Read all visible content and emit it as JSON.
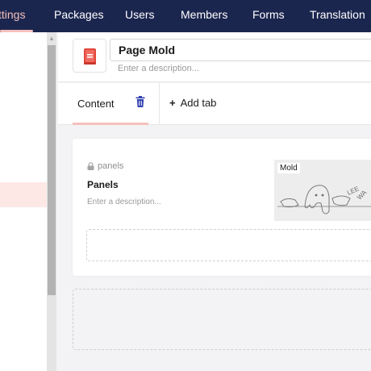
{
  "topnav": {
    "items": [
      {
        "label": "ttings",
        "active": true
      },
      {
        "label": "Packages",
        "active": false
      },
      {
        "label": "Users",
        "active": false
      },
      {
        "label": "Members",
        "active": false
      },
      {
        "label": "Forms",
        "active": false
      },
      {
        "label": "Translation",
        "active": false
      }
    ]
  },
  "document_type": {
    "name": "Page Mold",
    "description_placeholder": "Enter a description...",
    "icon": "document-icon"
  },
  "tabs": {
    "items": [
      {
        "label": "Content",
        "active": true
      }
    ],
    "add_label": "Add tab"
  },
  "group": {
    "alias": "panels",
    "name": "Panels",
    "description_placeholder": "Enter a description...",
    "thumbnail_label": "Mold"
  },
  "colors": {
    "nav_bg": "#1b264f",
    "accent": "#f5c1bc",
    "icon_red": "#e2473b",
    "trash_blue": "#3544b1"
  }
}
